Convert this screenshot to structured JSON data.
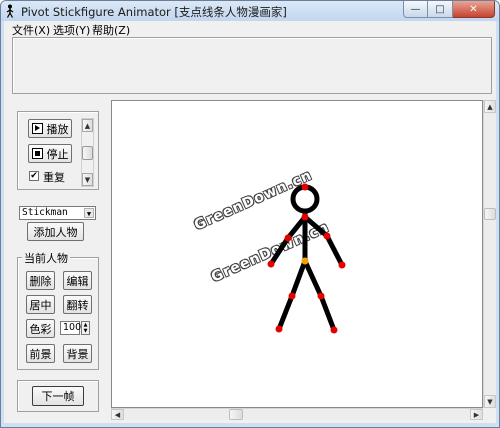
{
  "window": {
    "title": "Pivot Stickfigure Animator [支点线条人物漫画家]",
    "minimize_glyph": "—",
    "maximize_glyph": "□",
    "close_glyph": "✕"
  },
  "menu": [
    {
      "label": "文件(X)"
    },
    {
      "label": "选项(Y)"
    },
    {
      "label": "帮助(Z)"
    }
  ],
  "playback": {
    "play_label": "播放",
    "stop_label": "停止",
    "loop_label": "重复",
    "loop_checked": true,
    "checkmark": "✔"
  },
  "figure_select": {
    "value": "Stickman",
    "add_label": "添加人物"
  },
  "current_figure": {
    "title": "当前人物",
    "delete_label": "删除",
    "edit_label": "编辑",
    "center_label": "居中",
    "flip_label": "翻转",
    "color_label": "色彩",
    "size_value": "100",
    "front_label": "前景",
    "back_label": "背景"
  },
  "next_frame_label": "下一帧",
  "canvas": {
    "watermark_1": "GreenDown.cn",
    "watermark_2": "GreenDown.cn",
    "joint_color": "#e60000",
    "center_joint_color": "#f5a000",
    "line_color": "#000000"
  },
  "scroll_arrows": {
    "up": "▲",
    "down": "▼",
    "left": "◀",
    "right": "▶"
  }
}
